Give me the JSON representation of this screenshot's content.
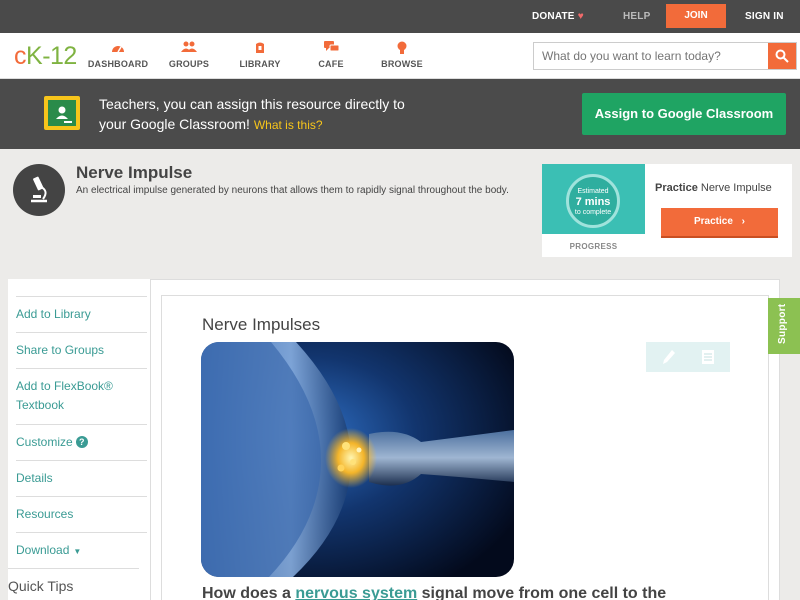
{
  "topbar": {
    "donate": "DONATE",
    "help": "HELP",
    "join": "JOIN",
    "signin": "SIGN IN"
  },
  "logo": {
    "c": "c",
    "k": "K",
    "dash": "-",
    "num": "12"
  },
  "nav": {
    "dashboard": "DASHBOARD",
    "groups": "GROUPS",
    "library": "LIBRARY",
    "cafe": "CAFE",
    "browse": "BROWSE"
  },
  "search": {
    "placeholder": "What do you want to learn today?"
  },
  "banner": {
    "line1": "Teachers, you can assign this resource directly to",
    "line2": "your Google Classroom!",
    "whatis": "What is this?",
    "assign": "Assign to Google Classroom"
  },
  "concept": {
    "title": "Nerve Impulse",
    "description": "An electrical impulse generated by neurons that allows them to rapidly signal throughout the body."
  },
  "practice": {
    "estimated": "Estimated",
    "mins": "7 mins",
    "complete": "to complete",
    "progress_label": "PROGRESS",
    "heading_bold": "Practice",
    "heading_rest": "Nerve Impulse",
    "button": "Practice"
  },
  "sidebar": {
    "items": [
      {
        "label": "Add to Library"
      },
      {
        "label": "Share to Groups"
      },
      {
        "label": "Add to FlexBook® Textbook"
      },
      {
        "label": "Customize"
      },
      {
        "label": "Details"
      },
      {
        "label": "Resources"
      },
      {
        "label": "Download"
      }
    ],
    "help_badge": "?",
    "quick_tips": "Quick Tips"
  },
  "content": {
    "title": "Nerve Impulses",
    "question_start": "How does a ",
    "question_keyword": "nervous system",
    "question_end": " signal move from one cell to the"
  },
  "support": "Support",
  "colors": {
    "accent_orange": "#f26b3a",
    "brand_green": "#7fb341",
    "link_teal": "#3a9b94",
    "google_green": "#1fa463",
    "support_green": "#8cc152"
  }
}
